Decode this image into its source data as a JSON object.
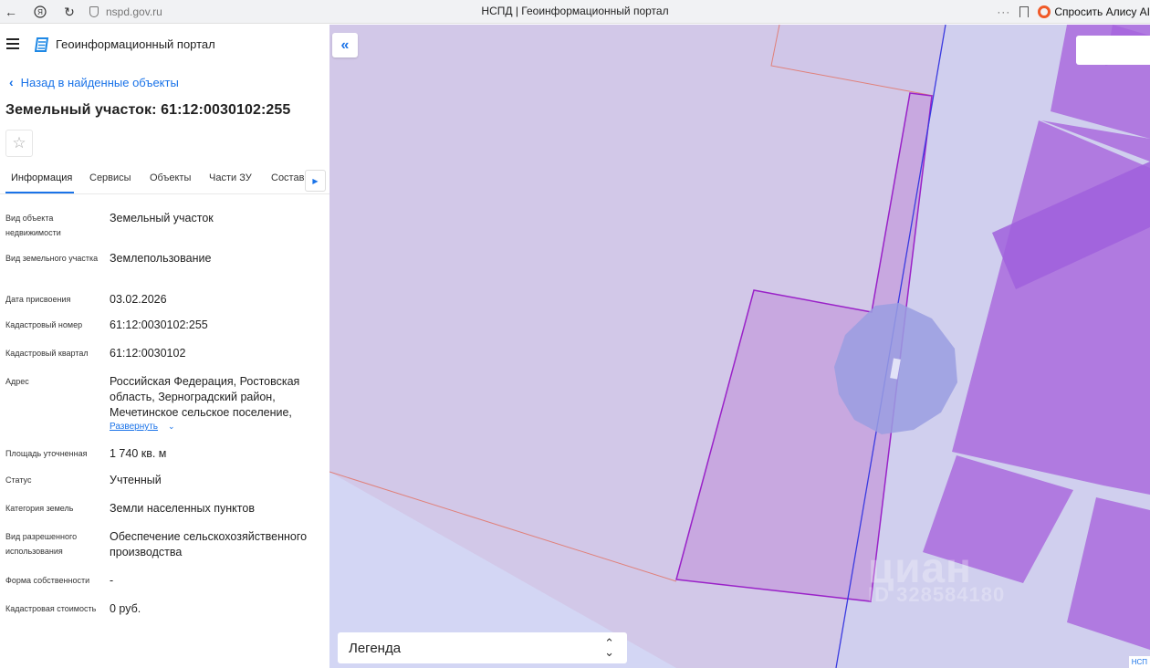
{
  "browser": {
    "url": "nspd.gov.ru",
    "title": "НСПД | Геоинформационный портал",
    "more": "···",
    "alice": "Спросить Алису AI",
    "icons": [
      "back-icon",
      "yandex-icon",
      "reload-icon",
      "shield-icon",
      "more-icon",
      "bookmark-icon",
      "alice-icon"
    ]
  },
  "header": {
    "app_title": "Геоинформационный портал"
  },
  "nav": {
    "back": "Назад в найденные объекты"
  },
  "object": {
    "title": "Земельный участок: 61:12:0030102:255"
  },
  "tabs": [
    "Информация",
    "Сервисы",
    "Объекты",
    "Части ЗУ",
    "Состав"
  ],
  "active_tab": "Информация",
  "fields": [
    {
      "label": "Вид объекта недвижимости",
      "value": "Земельный участок"
    },
    {
      "label": "Вид земельного участка",
      "value": "Землепользование"
    },
    {
      "label": "Дата присвоения",
      "value": "03.02.2026"
    },
    {
      "label": "Кадастровый номер",
      "value": "61:12:0030102:255"
    },
    {
      "label": "Кадастровый квартал",
      "value": "61:12:0030102"
    },
    {
      "label": "Адрес",
      "value": "Российская Федерация, Ростовская область, Зерноградский район, Мечетинское сельское поселение,"
    },
    {
      "label": "Площадь уточненная",
      "value": "1 740 кв. м"
    },
    {
      "label": "Статус",
      "value": "Учтенный"
    },
    {
      "label": "Категория земель",
      "value": "Земли населенных пунктов"
    },
    {
      "label": "Вид разрешенного использования",
      "value": "Обеспечение сельскохозяйственного производства"
    },
    {
      "label": "Форма собственности",
      "value": "-"
    },
    {
      "label": "Кадастровая стоимость",
      "value": "0 руб."
    }
  ],
  "address_expand": "Развернуть",
  "map": {
    "collapse": "«",
    "legend": "Легенда",
    "watermark": "циан",
    "watermark_id": "ID 328584180",
    "corner": "НСП",
    "colors": {
      "background": "#d3d6f4",
      "parcel_light": "#d2c8e8",
      "parcel_selected": "#c8a8e0",
      "building": "#b07ae0",
      "border_selected": "#9a22c8",
      "border_blue": "#3a3ae0",
      "circle": "#9a9ee0"
    }
  },
  "colors": {
    "accent": "#1a73e8"
  }
}
